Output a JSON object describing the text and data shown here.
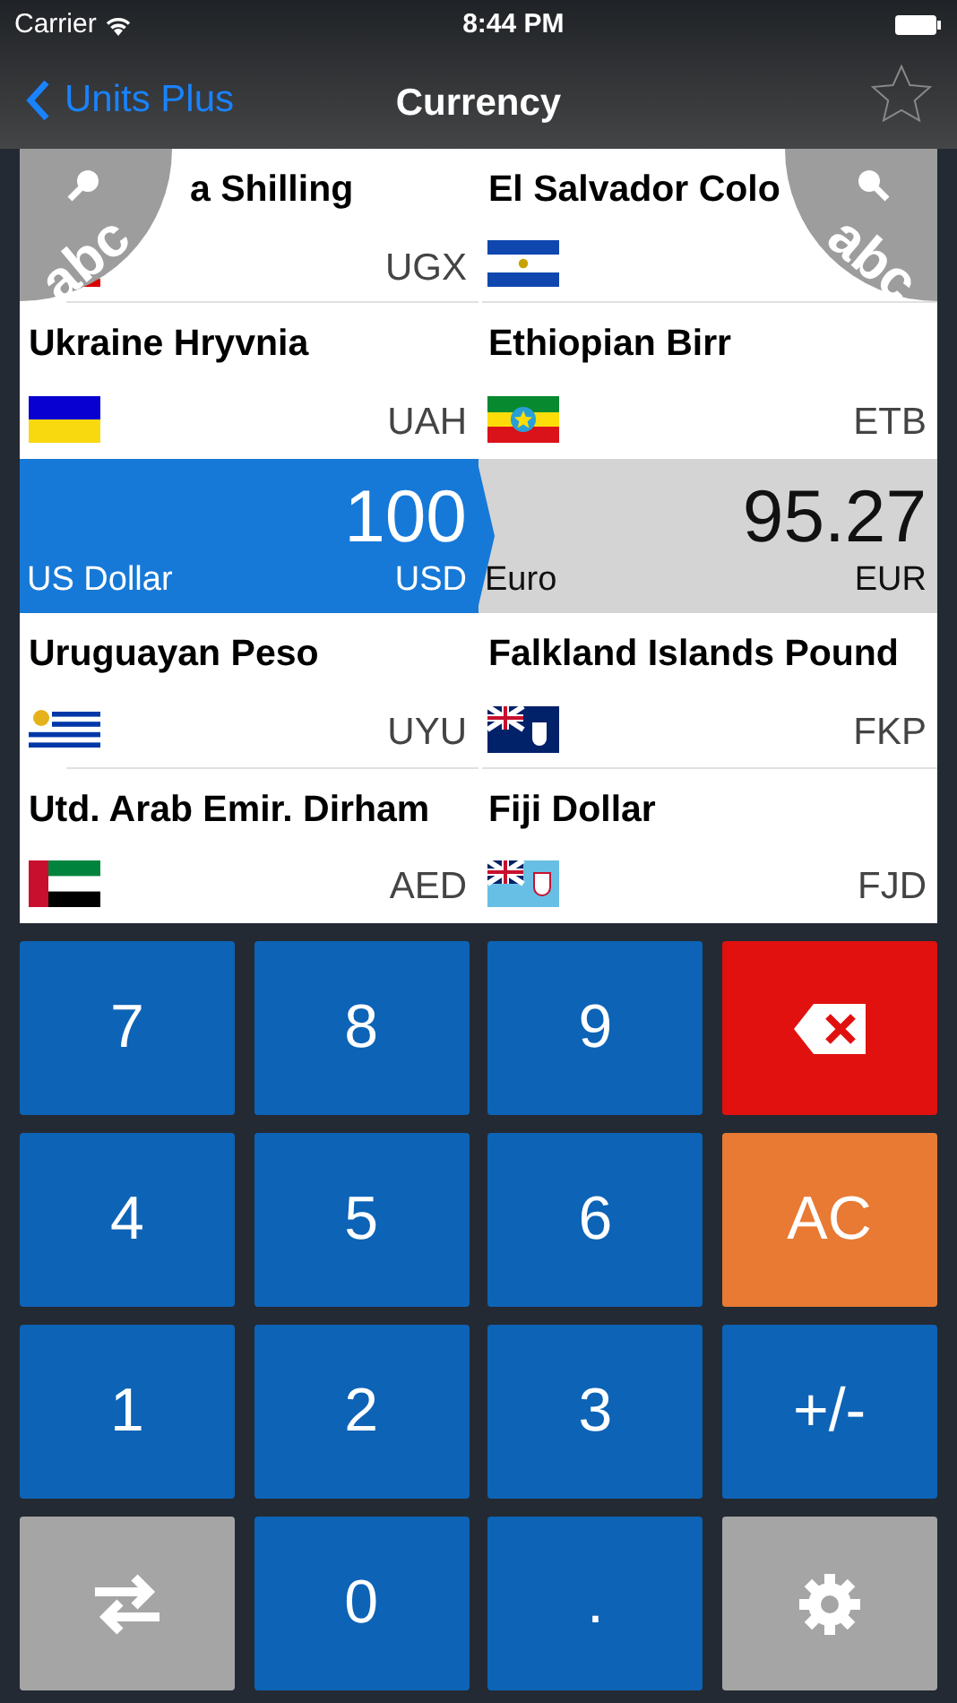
{
  "status_bar": {
    "carrier": "Carrier",
    "time": "8:44 PM"
  },
  "nav": {
    "back": "Units Plus",
    "title": "Currency",
    "favorite": false
  },
  "index_tabs": [
    {
      "label": "abc"
    },
    {
      "label": "abc"
    }
  ],
  "rows": [
    {
      "selected": false,
      "left": {
        "name": "a Shilling",
        "code": "UGX",
        "kind": "ug"
      },
      "right": {
        "name": "El Salvador Colo",
        "kind": "sv"
      }
    },
    {
      "selected": false,
      "left": {
        "name": "Ukraine Hryvnia",
        "code": "UAH",
        "kind": "ua"
      },
      "right": {
        "name": "Ethiopian Birr",
        "code": "ETB",
        "kind": "et"
      }
    },
    {
      "selected": true,
      "left": {
        "value": "100",
        "name": "US Dollar",
        "code": "USD"
      },
      "right": {
        "value": "95.27",
        "name": "Euro",
        "code": "EUR"
      }
    },
    {
      "selected": false,
      "left": {
        "name": "Uruguayan Peso",
        "code": "UYU",
        "kind": "uy"
      },
      "right": {
        "name": "Falkland Islands Pound",
        "code": "FKP",
        "kind": "fk"
      }
    },
    {
      "selected": false,
      "left": {
        "name": "Utd. Arab Emir. Dirham",
        "code": "AED",
        "kind": "ae"
      },
      "right": {
        "name": "Fiji Dollar",
        "code": "FJD",
        "kind": "fj"
      }
    }
  ],
  "keys": [
    {
      "kind": "digit",
      "label": "7"
    },
    {
      "kind": "digit",
      "label": "8"
    },
    {
      "kind": "digit",
      "label": "9"
    },
    {
      "kind": "backspace"
    },
    {
      "kind": "digit",
      "label": "4"
    },
    {
      "kind": "digit",
      "label": "5"
    },
    {
      "kind": "digit",
      "label": "6"
    },
    {
      "kind": "clear",
      "label": "AC"
    },
    {
      "kind": "digit",
      "label": "1"
    },
    {
      "kind": "digit",
      "label": "2"
    },
    {
      "kind": "digit",
      "label": "3"
    },
    {
      "kind": "digit",
      "label": "+/-"
    },
    {
      "kind": "swap"
    },
    {
      "kind": "digit",
      "label": "0"
    },
    {
      "kind": "digit",
      "label": "."
    },
    {
      "kind": "settings"
    }
  ]
}
